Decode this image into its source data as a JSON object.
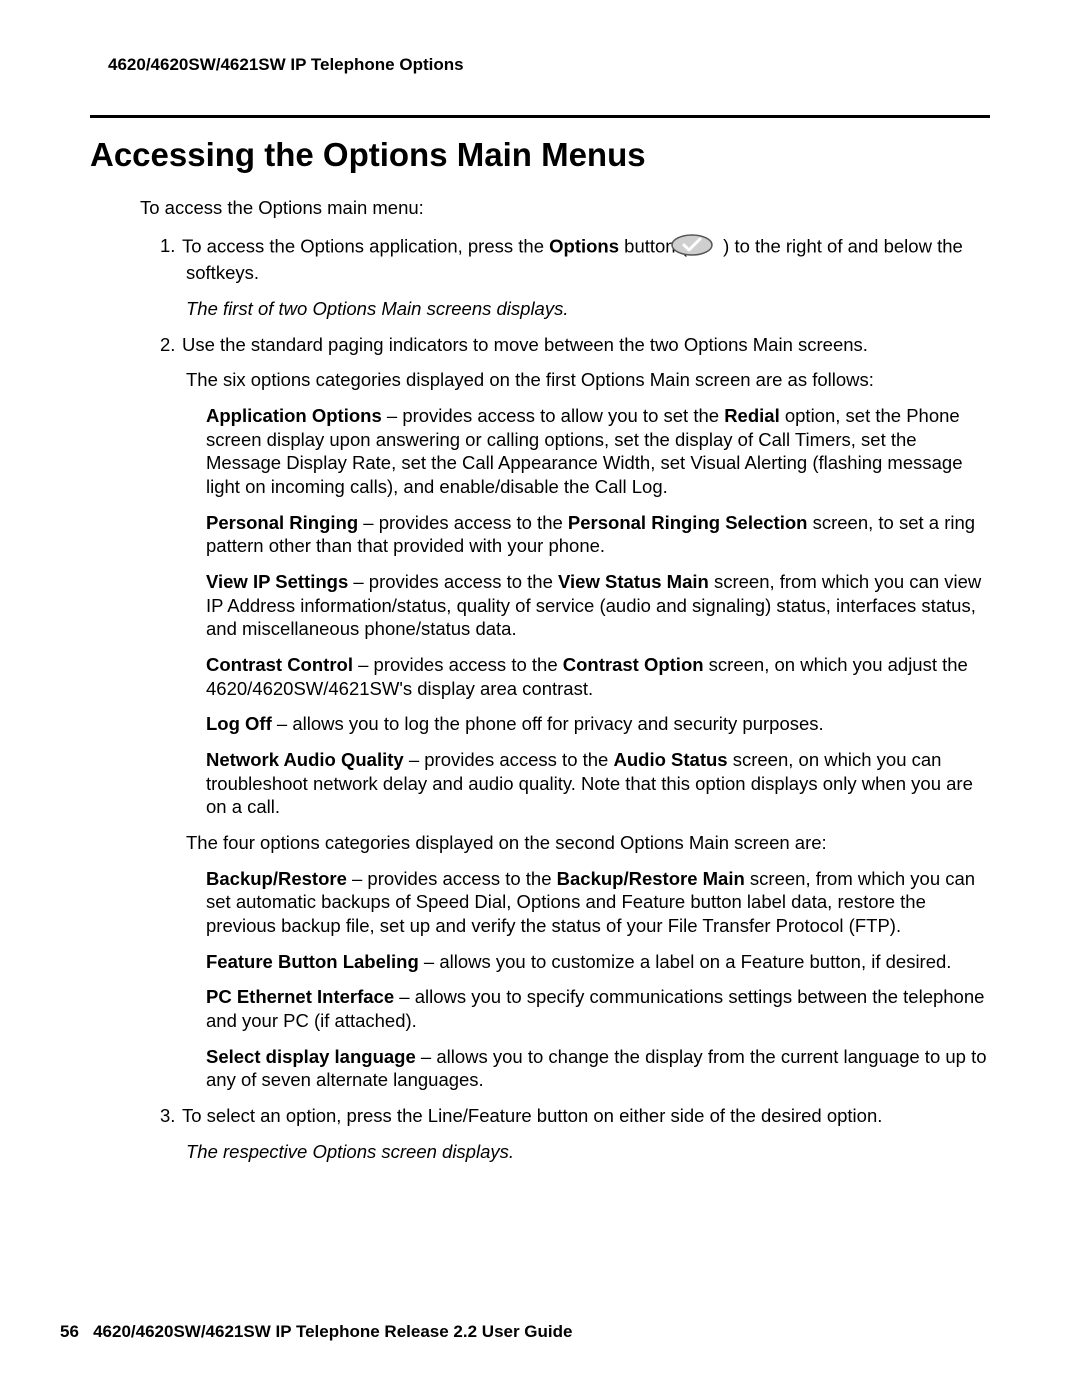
{
  "header": {
    "running_head": "4620/4620SW/4621SW IP Telephone Options"
  },
  "title": "Accessing the Options Main Menus",
  "intro": "To access the Options main menu:",
  "steps": {
    "s1_pre": "To access the Options application, press the ",
    "s1_bold": "Options",
    "s1_mid": " button ( ",
    "s1_post": " ) to the right of and below the softkeys.",
    "s1_italic": "The first of two Options Main screens displays.",
    "s2_intro": "Use the standard paging indicators to move between the two Options Main screens.",
    "s2_lead": "The six options categories displayed on the first Options Main screen are as follows:",
    "app_opt_b": "Application Options",
    "app_opt_t1": " – provides access to allow you to set the ",
    "app_opt_b2": "Redial",
    "app_opt_t2": " option, set the Phone screen display upon answering or calling options, set the display of Call Timers, set the Message Display Rate, set the Call Appearance Width, set Visual Alerting (flashing message light on incoming calls), and enable/disable the Call Log.",
    "pr_b": "Personal Ringing",
    "pr_t1": " – provides access to the ",
    "pr_b2": "Personal Ringing Selection",
    "pr_t2": " screen, to set a ring pattern other than that provided with your phone.",
    "vip_b": "View IP Settings",
    "vip_t1": " – provides access to the ",
    "vip_b2": "View Status Main",
    "vip_t2": " screen, from which you can view IP Address information/status, quality of service (audio and signaling) status, interfaces status, and miscellaneous phone/status data.",
    "cc_b": "Contrast Control",
    "cc_t1": " – provides access to the ",
    "cc_b2": "Contrast Option",
    "cc_t2": " screen, on which you adjust the 4620/4620SW/4621SW's display area contrast.",
    "lo_b": "Log Off",
    "lo_t": " – allows you to log the phone off for privacy and security purposes.",
    "naq_b": "Network Audio Quality",
    "naq_t1": " – provides access to the ",
    "naq_b2": "Audio Status",
    "naq_t2": " screen, on which you can troubleshoot network delay and audio quality. Note that this option displays only when you are on a call.",
    "second_lead": "The four options categories displayed on the second Options Main screen are:",
    "br_b": "Backup/Restore",
    "br_t1": " – provides access to the ",
    "br_b2": "Backup/Restore Main",
    "br_t2": " screen, from which you can set automatic backups of Speed Dial, Options and Feature button label data, restore the previous backup file, set up and verify the status of your File Transfer Protocol (FTP).",
    "fbl_b": "Feature Button Labeling",
    "fbl_t": " – allows you to customize a label on a Feature button, if desired.",
    "pce_b": "PC Ethernet Interface",
    "pce_t": " – allows you to specify communications settings between the telephone and your PC (if attached).",
    "sdl_b": "Select display language",
    "sdl_t": " – allows you to change the display from the current language to up to any of seven alternate languages.",
    "s3": "To select an option, press the Line/Feature button on either side of the desired option.",
    "s3_italic": "The respective Options screen displays."
  },
  "footer": {
    "page_no": "56",
    "text": "4620/4620SW/4621SW IP Telephone Release 2.2 User Guide"
  },
  "icon": {
    "semantic": "options-check-icon"
  }
}
